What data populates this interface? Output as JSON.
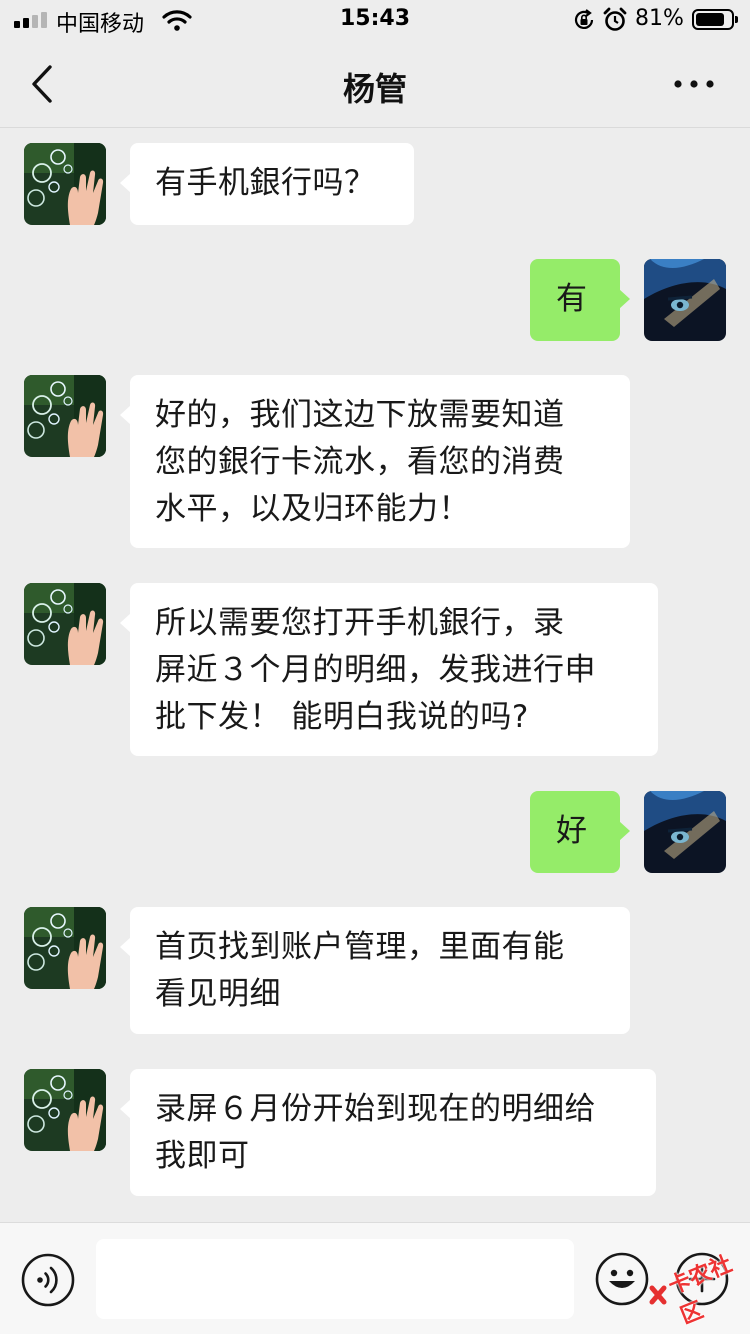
{
  "status_bar": {
    "carrier": "中国移动",
    "time": "15:43",
    "battery_percent": "81%",
    "battery_level": 0.81,
    "signal_bars": 2,
    "icons": [
      "signal-icon",
      "wifi-icon",
      "rotation-lock-icon",
      "alarm-icon",
      "battery-icon"
    ]
  },
  "nav": {
    "title": "杨管",
    "back_icon": "chevron-left-icon",
    "more_icon": "more-icon"
  },
  "messages": [
    {
      "sender": "contact",
      "text": "有手机銀行吗？"
    },
    {
      "sender": "self",
      "text": "有"
    },
    {
      "sender": "contact",
      "text": "好的，我们这边下放需要知道\n您的銀行卡流水，看您的消费\n水平，以及归环能力！"
    },
    {
      "sender": "contact",
      "text": "所以需要您打开手机銀行，录\n屏近３个月的明细，发我进行申\n批下发！ 能明白我说的吗?"
    },
    {
      "sender": "self",
      "text": "好"
    },
    {
      "sender": "contact",
      "text": "首页找到账户管理，里面有能\n看见明细"
    },
    {
      "sender": "contact",
      "text": "录屏６月份开始到现在的明细给\n我即可"
    }
  ],
  "input_bar": {
    "placeholder": "",
    "voice_icon": "voice-icon",
    "emoji_icon": "emoji-icon",
    "plus_icon": "plus-icon"
  },
  "watermark": {
    "text": "卡农社区"
  },
  "colors": {
    "background": "#ededed",
    "incoming_bubble": "#ffffff",
    "outgoing_bubble": "#95ec69",
    "input_bar": "#f7f7f7"
  }
}
